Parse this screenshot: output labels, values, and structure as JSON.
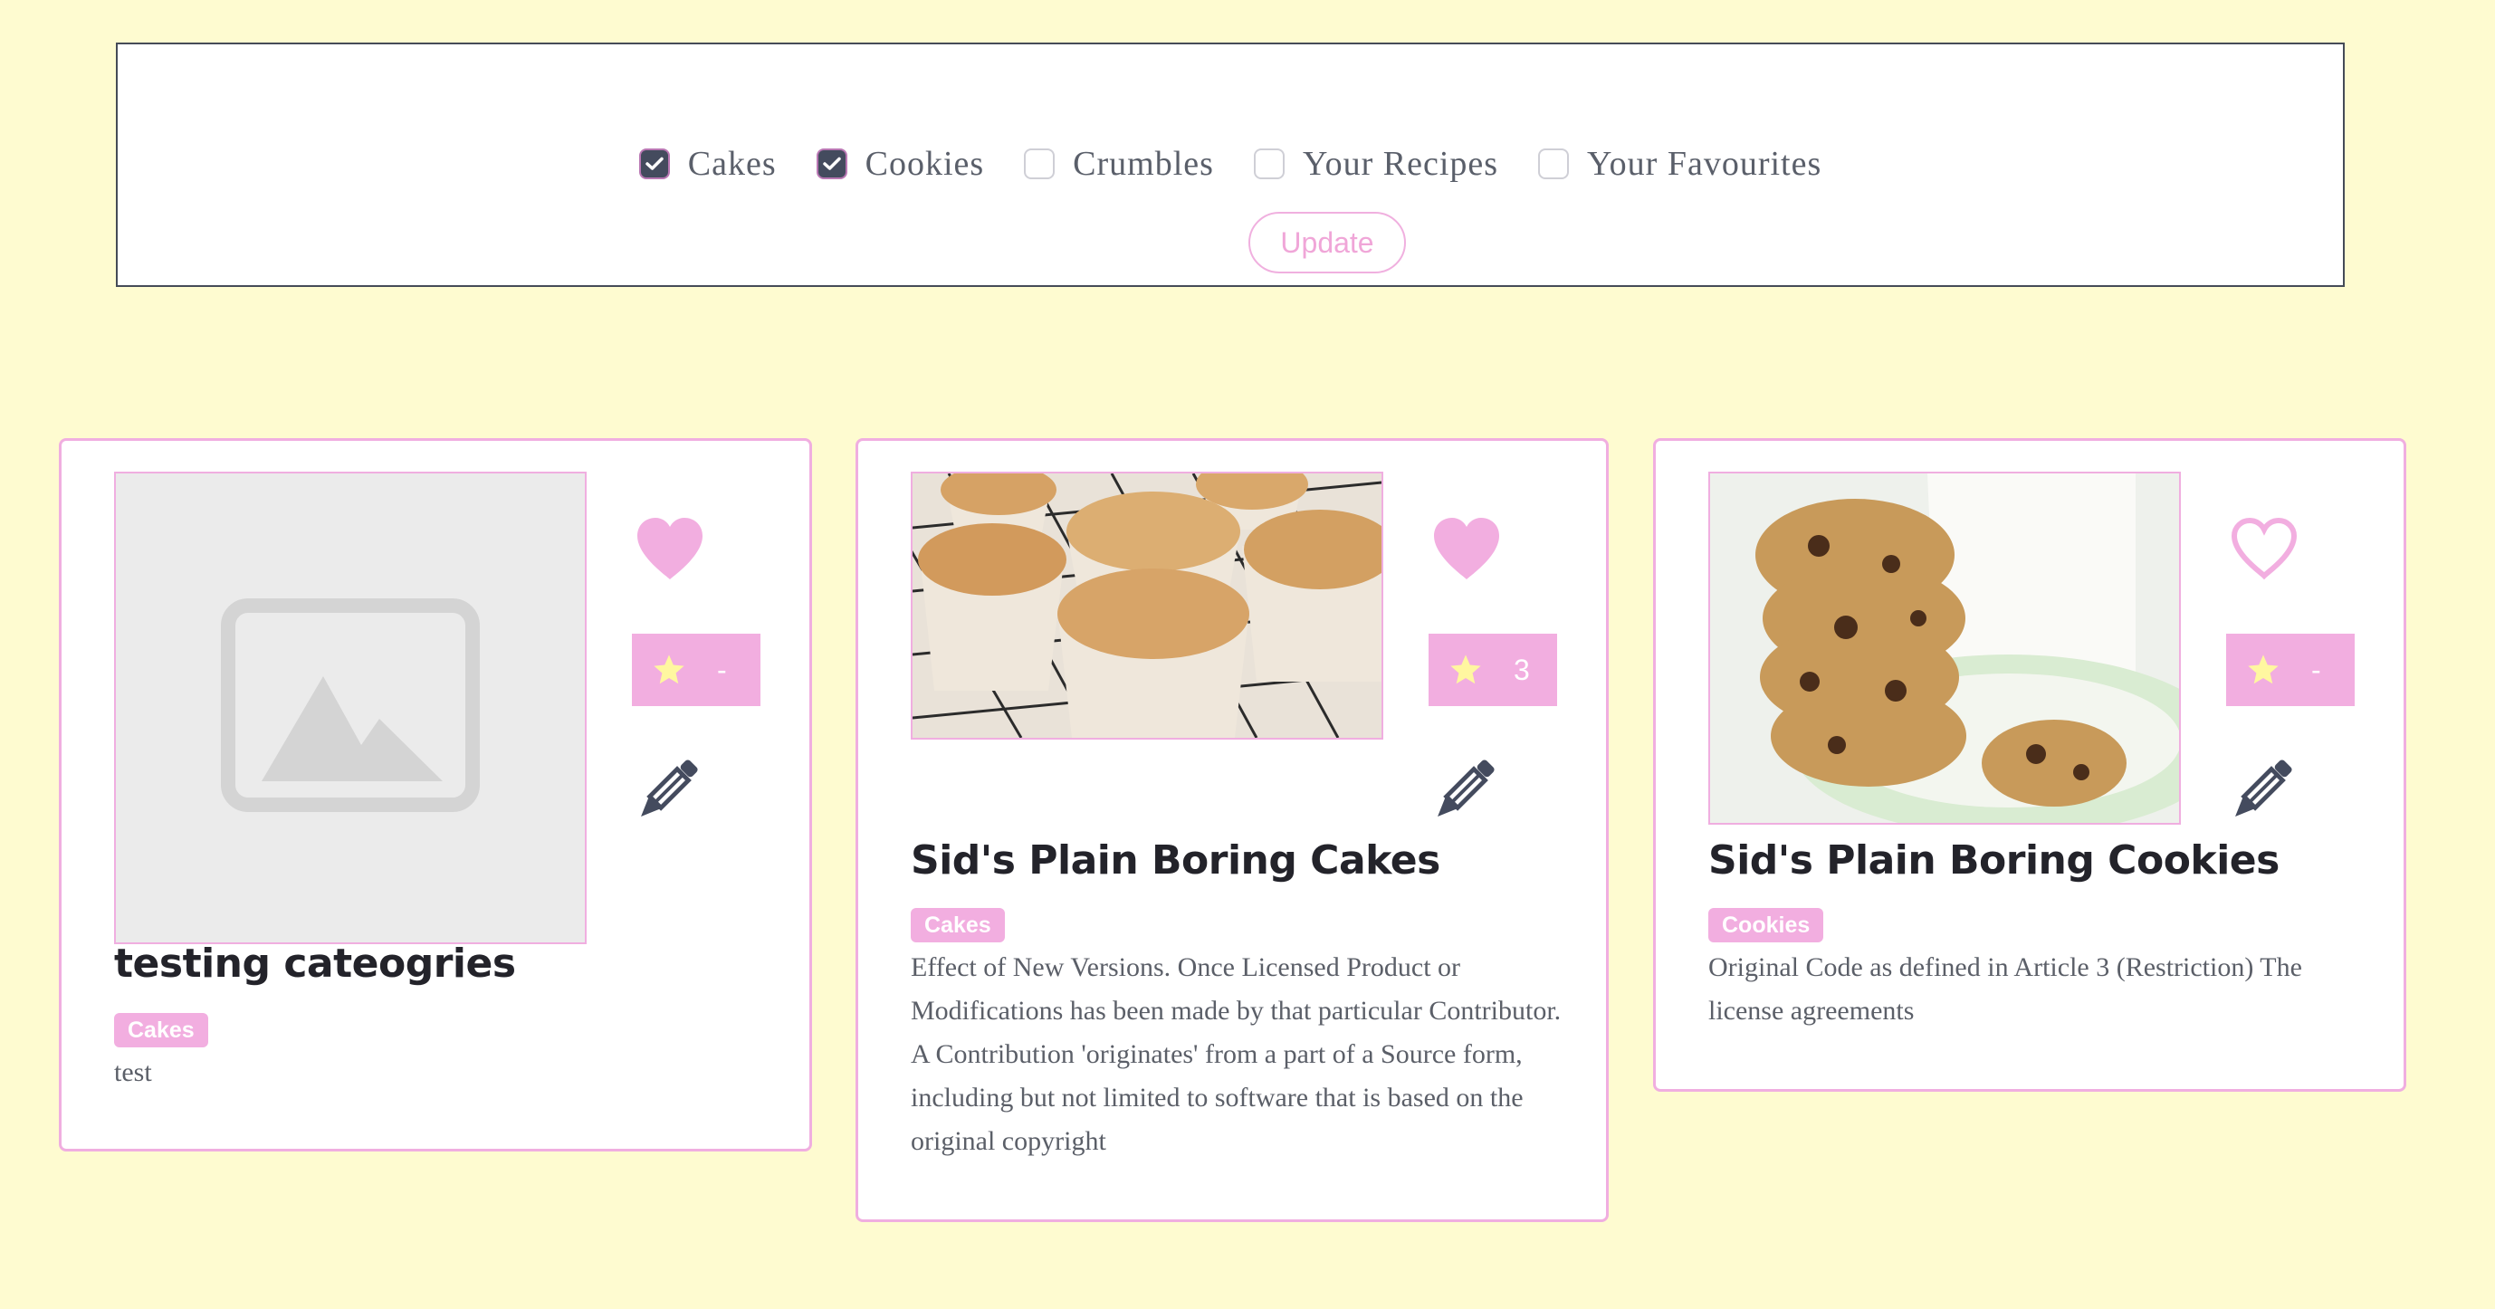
{
  "filters": {
    "options": [
      {
        "label": "Cakes",
        "checked": true
      },
      {
        "label": "Cookies",
        "checked": true
      },
      {
        "label": "Crumbles",
        "checked": false
      },
      {
        "label": "Your Recipes",
        "checked": false
      },
      {
        "label": "Your Favourites",
        "checked": false
      }
    ],
    "update_label": "Update"
  },
  "cards": [
    {
      "title": "testing cateogries",
      "tag": "Cakes",
      "description": "test",
      "liked": true,
      "rating": "-",
      "image": "placeholder-image-icon"
    },
    {
      "title": "Sid's Plain Boring Cakes",
      "tag": "Cakes",
      "description": "Effect of New Versions. Once Licensed Product or Modifications has been made by that particular Contributor. A Contribution 'originates' from a part of a Source form, including but not limited to software that is based on the original copyright",
      "liked": true,
      "rating": "3",
      "image": "cupcakes-photo"
    },
    {
      "title": "Sid's Plain Boring Cookies",
      "tag": "Cookies",
      "description": "Original Code as defined in Article 3 (Restriction) The license agreements",
      "liked": false,
      "rating": "-",
      "image": "cookies-photo"
    }
  ],
  "colors": {
    "background": "#fefbd0",
    "accent_pink": "#f2aee0",
    "checkbox_checked": "#444b5e",
    "star_yellow": "#fff7a0",
    "icon_dark": "#444b5e"
  }
}
